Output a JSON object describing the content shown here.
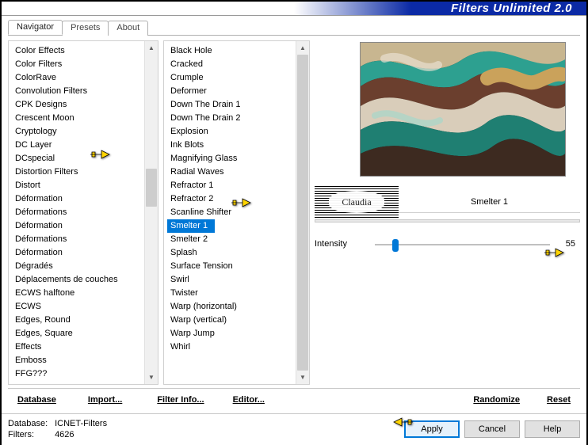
{
  "title": "Filters Unlimited 2.0",
  "tabs": [
    {
      "label": "Navigator",
      "active": true
    },
    {
      "label": "Presets",
      "active": false
    },
    {
      "label": "About",
      "active": false
    }
  ],
  "categories": {
    "scroll": {
      "thumb_top_pct": 36,
      "thumb_height_pct": 12
    },
    "items": [
      "Color Effects",
      "Color Filters",
      "ColorRave",
      "Convolution Filters",
      "CPK Designs",
      "Crescent Moon",
      "Cryptology",
      "DC Layer",
      "DCspecial",
      "Distortion Filters",
      "Distort",
      "Déformation",
      "Déformations",
      "Déformation",
      "Déformations",
      "Déformation",
      "Dégradés",
      "Déplacements de couches",
      "ECWS halftone",
      "ECWS",
      "Edges, Round",
      "Edges, Square",
      "Effects",
      "Emboss",
      "FFG???"
    ],
    "marked_index": 9
  },
  "filters": {
    "scroll": {
      "thumb_top_pct": 0,
      "thumb_height_pct": 100
    },
    "items": [
      "Black Hole",
      "Cracked",
      "Crumple",
      "Deformer",
      "Down The Drain 1",
      "Down The Drain 2",
      "Explosion",
      "Ink Blots",
      "Magnifying Glass",
      "Radial Waves",
      "Refractor 1",
      "Refractor 2",
      "Scanline Shifter",
      "Smelter 1",
      "Smelter 2",
      "Splash",
      "Surface Tension",
      "Swirl",
      "Twister",
      "Warp (horizontal)",
      "Warp (vertical)",
      "Warp Jump",
      "Whirl"
    ],
    "selected_index": 13
  },
  "watermark": "Claudia",
  "current_filter": "Smelter 1",
  "params": [
    {
      "label": "Intensity",
      "value": 55,
      "min": 0,
      "max": 255,
      "thumb_pct": 10
    }
  ],
  "commands": {
    "database": "Database",
    "import": "Import...",
    "filter_info": "Filter Info...",
    "editor": "Editor...",
    "randomize": "Randomize",
    "reset": "Reset"
  },
  "footer": {
    "db_label": "Database:",
    "db_value": "ICNET-Filters",
    "filters_label": "Filters:",
    "filters_value": "4626",
    "apply": "Apply",
    "cancel": "Cancel",
    "help": "Help"
  }
}
